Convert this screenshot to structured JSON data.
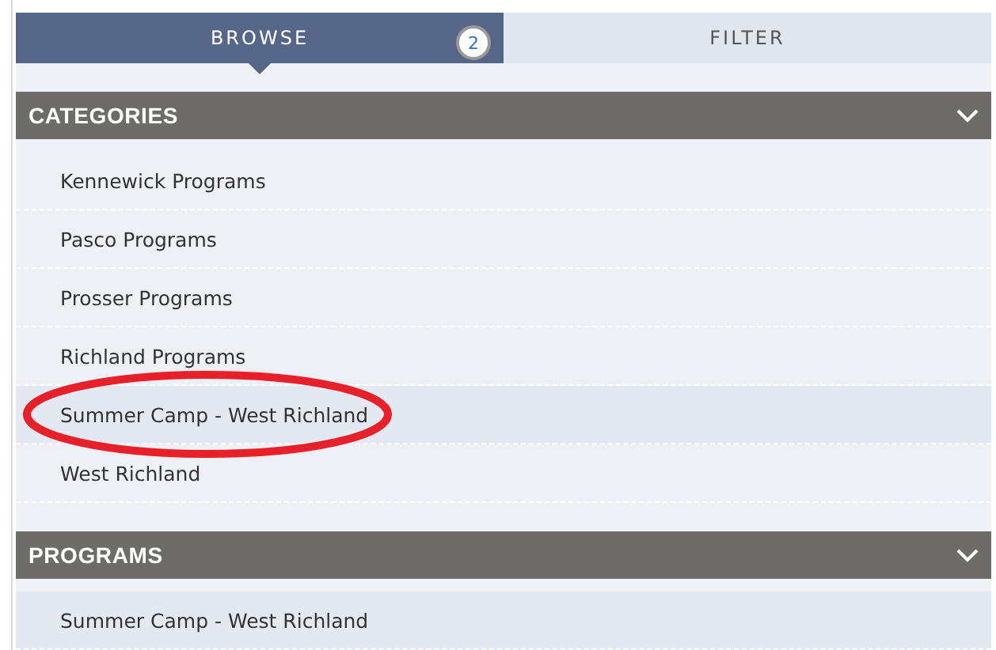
{
  "tabs": [
    {
      "label": "BROWSE",
      "selected": true,
      "badge": "2"
    },
    {
      "label": "FILTER",
      "selected": false
    }
  ],
  "sections": [
    {
      "title": "CATEGORIES",
      "expanded": true,
      "items": [
        {
          "label": "Kennewick Programs",
          "selected": false,
          "circled": false
        },
        {
          "label": "Pasco Programs",
          "selected": false,
          "circled": false
        },
        {
          "label": "Prosser Programs",
          "selected": false,
          "circled": false
        },
        {
          "label": "Richland Programs",
          "selected": false,
          "circled": false
        },
        {
          "label": "Summer Camp - West Richland",
          "selected": true,
          "circled": true
        },
        {
          "label": "West Richland",
          "selected": false,
          "circled": false
        }
      ]
    },
    {
      "title": "PROGRAMS",
      "expanded": true,
      "items": [
        {
          "label": "Summer Camp - West Richland",
          "selected": true,
          "circled": false
        }
      ]
    }
  ]
}
